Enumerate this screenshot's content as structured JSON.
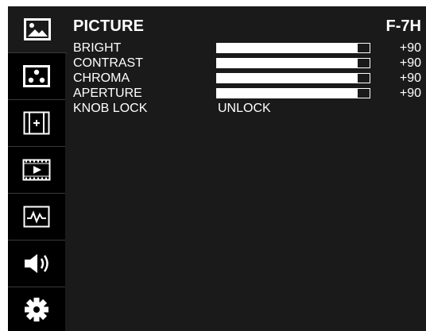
{
  "header": {
    "title": "PICTURE",
    "model": "F-7H"
  },
  "rail": {
    "items": [
      {
        "icon": "picture-icon",
        "active": true
      },
      {
        "icon": "color-dots-icon",
        "active": false
      },
      {
        "icon": "marker-icon",
        "active": false
      },
      {
        "icon": "film-icon",
        "active": false
      },
      {
        "icon": "waveform-icon",
        "active": false
      },
      {
        "icon": "speaker-icon",
        "active": false
      },
      {
        "icon": "gear-icon",
        "active": false
      }
    ]
  },
  "settings": {
    "bright": {
      "label": "BRIGHT",
      "value": "+90",
      "level": 0.92
    },
    "contrast": {
      "label": "CONTRAST",
      "value": "+90",
      "level": 0.92
    },
    "chroma": {
      "label": "CHROMA",
      "value": "+90",
      "level": 0.92
    },
    "aperture": {
      "label": "APERTURE",
      "value": "+90",
      "level": 0.92
    },
    "knob_lock": {
      "label": "KNOB LOCK",
      "value": "UNLOCK"
    }
  },
  "colors": {
    "background": "#1a1a1a",
    "rail": "#000000",
    "text": "#ffffff"
  }
}
